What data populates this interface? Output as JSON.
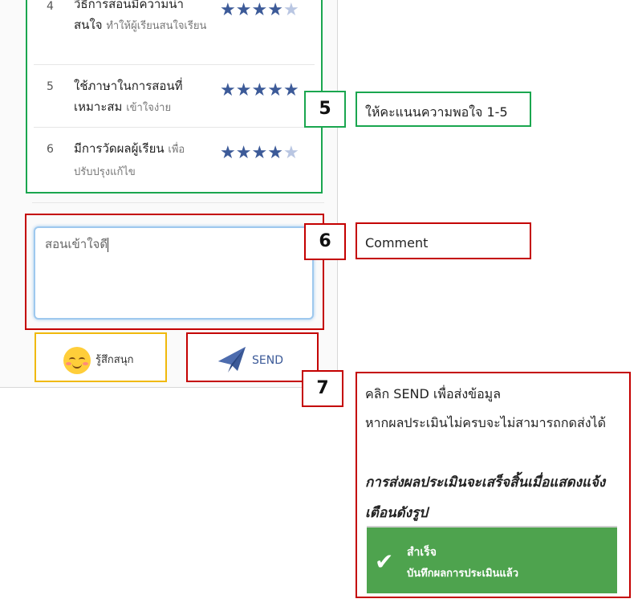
{
  "ratings": [
    {
      "num": "4",
      "title": "วิธีการสอนมีความน่าสนใจ",
      "sub": "ทำให้ผู้เรียนสนใจเรียน",
      "stars": 4
    },
    {
      "num": "5",
      "title": "ใช้ภาษาในการสอนที่เหมาะสม",
      "sub": "เข้าใจง่าย",
      "stars": 5
    },
    {
      "num": "6",
      "title": "มีการวัดผลผู้เรียน",
      "sub": "เพื่อปรับปรุงแก้ไข",
      "stars": 4
    }
  ],
  "star_glyph": "★",
  "comment": {
    "value": "สอนเข้าใจดี"
  },
  "buttons": {
    "fun_label": "รู้สึกสนุก",
    "send_label": "SEND"
  },
  "annotations": {
    "badge5": "5",
    "note5": "ให้คะแนนความพอใจ 1-5",
    "badge6": "6",
    "note6": "Comment",
    "badge7": "7",
    "note7_line1": "คลิก SEND เพื่อส่งข้อมูล",
    "note7_line2": "หากผลประเมินไม่ครบจะไม่สามารถกดส่งได้",
    "note7_bold1": "การส่งผลประเมินจะเสร็จสิ้นเมื่อแสดงแจ้ง",
    "note7_bold2": "เตือนดังรูป"
  },
  "toast": {
    "title": "สำเร็จ",
    "message": "บันทึกผลการประเมินแล้ว",
    "check": "✔"
  },
  "colors": {
    "green": "#1aa64f",
    "red": "#c40000",
    "star": "#3c5a98",
    "toast": "#4ea34e"
  }
}
